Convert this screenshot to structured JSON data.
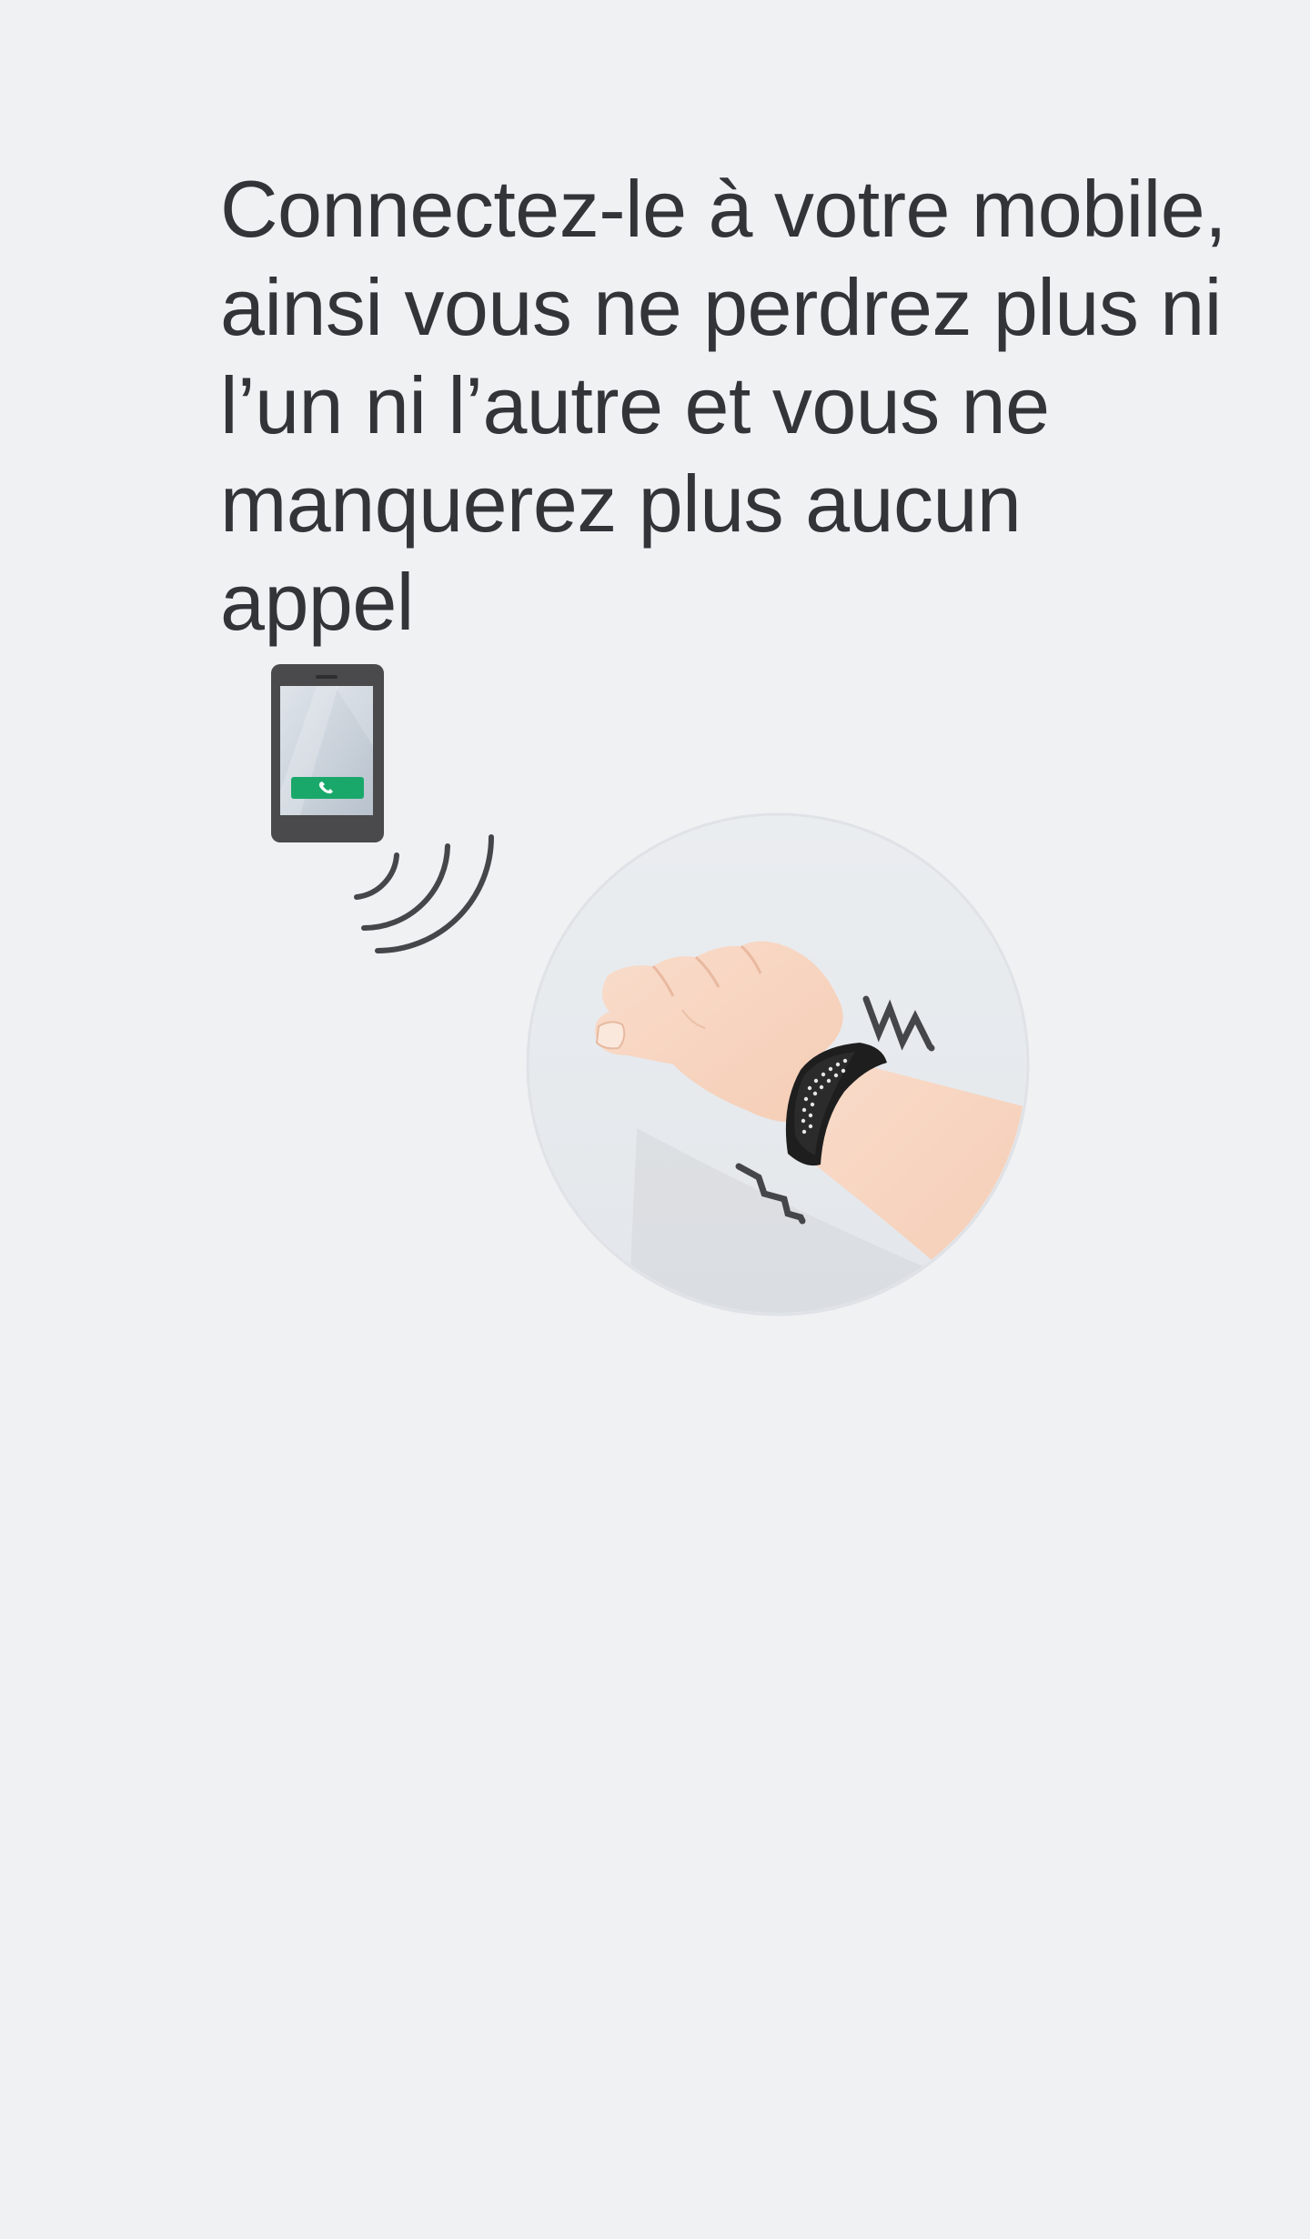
{
  "screen": {
    "background_color": "#f0f1f3",
    "headline_lines": [
      "Connectez-le à votre mobile,",
      "ainsi vous ne perdrez plus ni",
      "l’un ni l’autre et vous ne",
      "manquerez plus aucun",
      "appel"
    ]
  },
  "illustration": {
    "phone_icon": "smartphone-icon",
    "call_button_icon": "phone-handset-icon",
    "signal_icon": "wireless-signal-icon",
    "wrist_icon": "wristband-vibration-icon",
    "colors": {
      "text": "#333438",
      "call_green": "#1aa86a",
      "phone_body": "#4a4a4c",
      "band": "#1e1e1e",
      "skin": "#f7d2bd"
    }
  }
}
